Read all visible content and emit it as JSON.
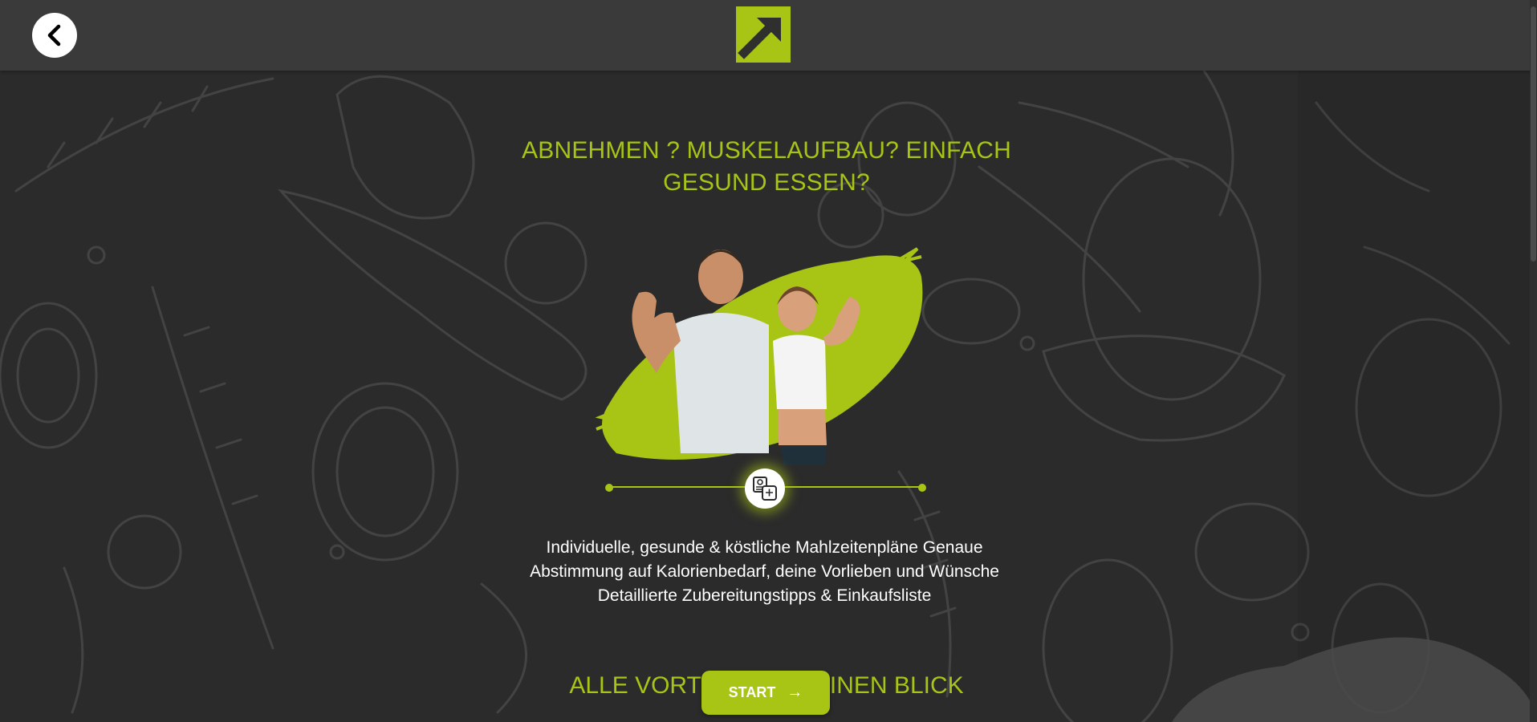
{
  "header": {
    "back_icon": "chevron-left-icon",
    "logo_icon": "arrow-up-right-logo"
  },
  "hero": {
    "headline": "ABNEHMEN ? MUSKELAUFBAU? EINFACH GESUND ESSEN?",
    "image": "smiling-man-and-woman-flexing-arms-on-green-brush-splash"
  },
  "timeline": {
    "icon": "meal-plan-icon"
  },
  "features": {
    "line1": "Individuelle, gesunde & köstliche Mahlzeitenpläne Genaue",
    "line2": "Abstimmung auf Kalorienbedarf, deine Vorlieben und Wünsche",
    "line3": "Detaillierte Zubereitungstipps & Einkaufsliste"
  },
  "section2": {
    "title": "ALLE VORTEILE AUF EINEN BLICK"
  },
  "cta": {
    "start_label": "START",
    "arrow_icon": "arrow-right-icon"
  },
  "colors": {
    "accent": "#a8c414",
    "background": "#2b2b2b",
    "topbar": "#3a3a3a"
  }
}
